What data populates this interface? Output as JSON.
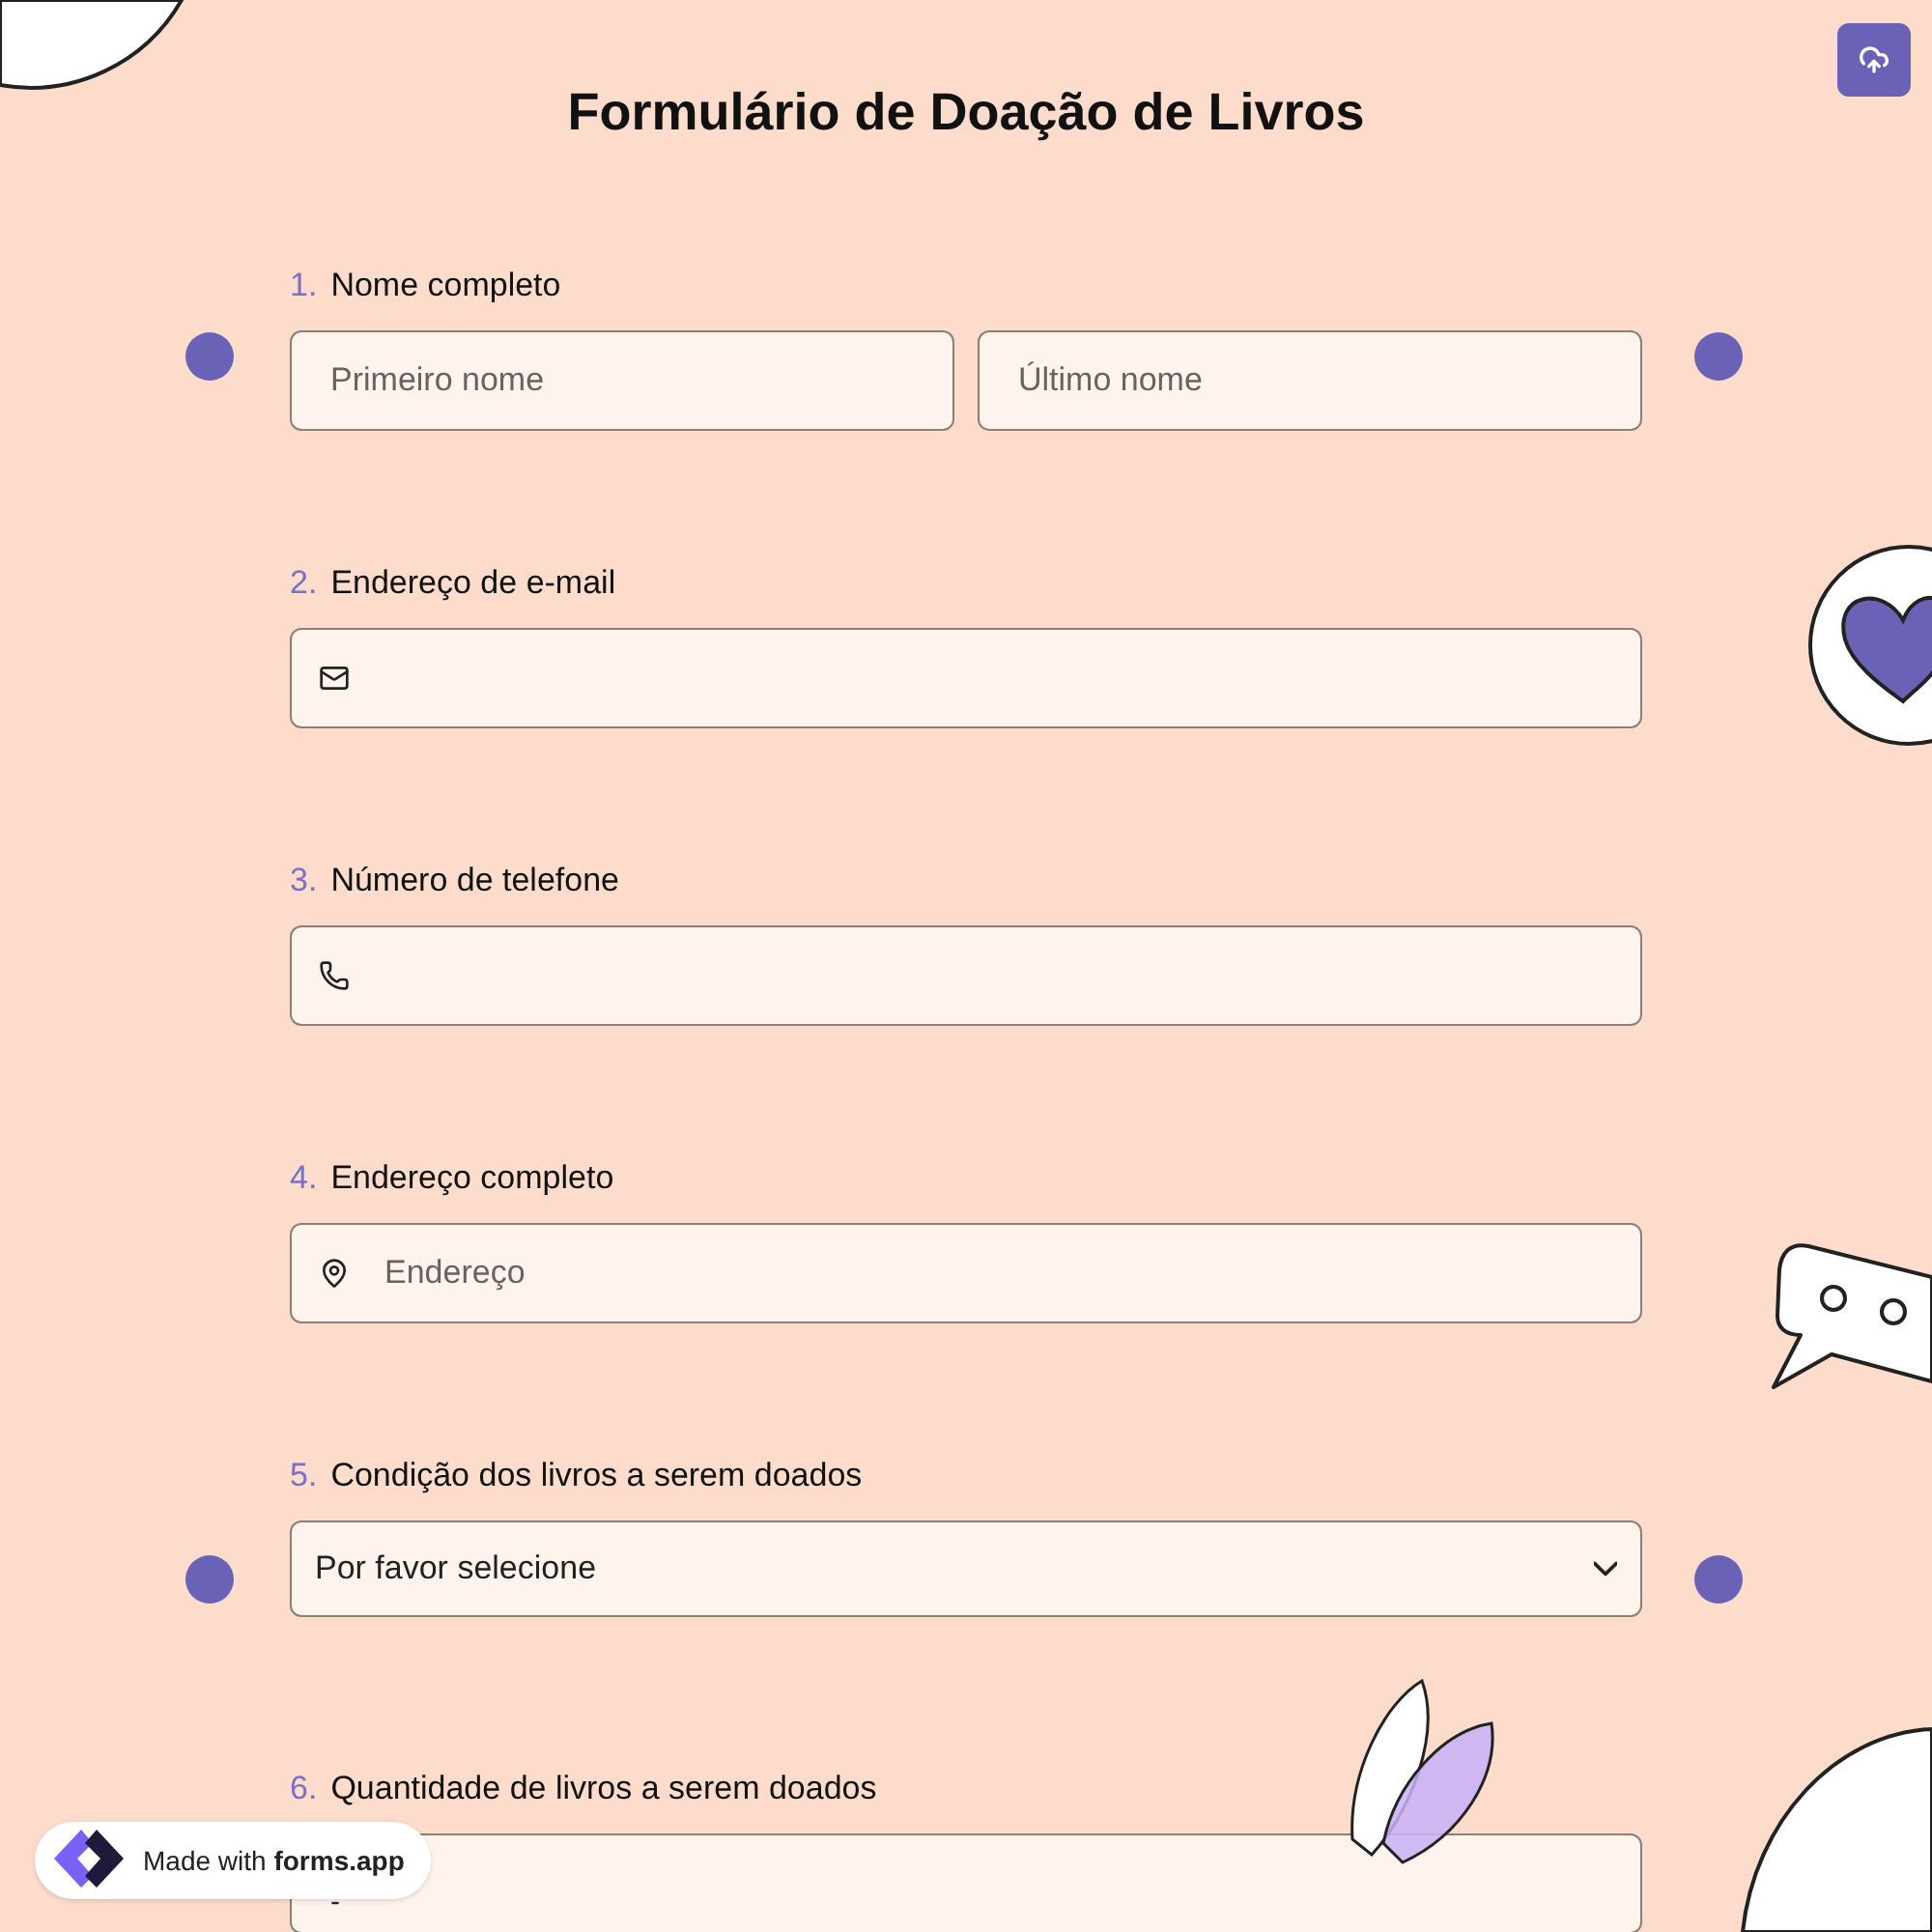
{
  "title": "Formulário de Doação de Livros",
  "questions": [
    {
      "number": "1.",
      "label": "Nome completo",
      "kind": "name",
      "fields": [
        {
          "placeholder": "Primeiro nome"
        },
        {
          "placeholder": "Último nome"
        }
      ]
    },
    {
      "number": "2.",
      "label": "Endereço de e-mail",
      "kind": "email"
    },
    {
      "number": "3.",
      "label": "Número de telefone",
      "kind": "phone"
    },
    {
      "number": "4.",
      "label": "Endereço completo",
      "kind": "address",
      "placeholder": "Endereço"
    },
    {
      "number": "5.",
      "label": "Condição dos livros a serem doados",
      "kind": "select",
      "value": "Por favor selecione"
    },
    {
      "number": "6.",
      "label": "Quantidade de livros a serem doados",
      "kind": "number",
      "value": "-"
    }
  ],
  "badge": {
    "text": "Made with ",
    "brand": "forms.app"
  }
}
